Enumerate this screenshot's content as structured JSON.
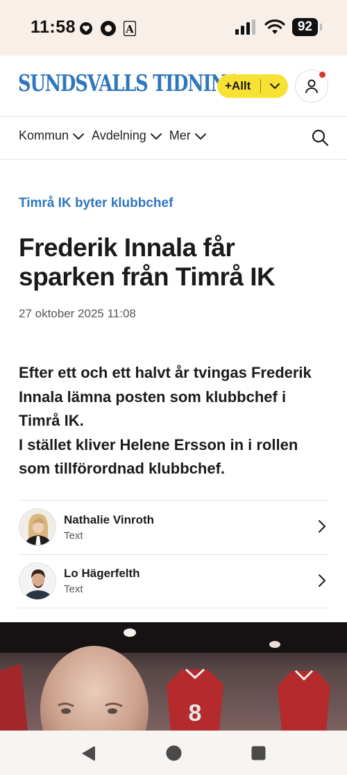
{
  "status_bar": {
    "time": "11:58",
    "battery": "92"
  },
  "header": {
    "logo": "SUNDSVALLS TIDNING",
    "plus_label": "+Allt"
  },
  "nav": {
    "items": [
      {
        "label": "Kommun"
      },
      {
        "label": "Avdelning"
      },
      {
        "label": "Mer"
      }
    ]
  },
  "article": {
    "kicker": "Timrå IK byter klubbchef",
    "headline": "Frederik Innala får sparken från Timrå IK",
    "timestamp": "27 oktober 2025 11:08",
    "lead_1": "Efter ett och ett halvt år tvingas Frederik Innala lämna posten som klubbchef i Timrå IK.",
    "lead_2": "I stället kliver Helene Ersson in i rollen som tillförordnad klubbchef."
  },
  "authors": [
    {
      "name": "Nathalie Vinroth",
      "role": "Text"
    },
    {
      "name": "Lo Hägerfelth",
      "role": "Text"
    }
  ],
  "colors": {
    "brand_blue": "#2f77bd",
    "plus_yellow": "#f7e233",
    "notification_red": "#d9342b"
  }
}
